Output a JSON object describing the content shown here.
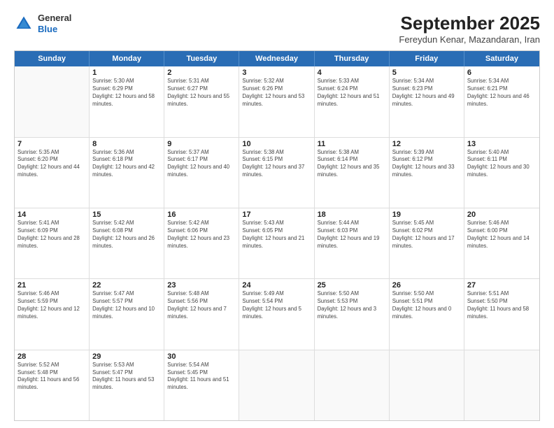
{
  "logo": {
    "general": "General",
    "blue": "Blue"
  },
  "title": "September 2025",
  "subtitle": "Fereydun Kenar, Mazandaran, Iran",
  "header_days": [
    "Sunday",
    "Monday",
    "Tuesday",
    "Wednesday",
    "Thursday",
    "Friday",
    "Saturday"
  ],
  "weeks": [
    [
      {
        "day": "",
        "sunrise": "",
        "sunset": "",
        "daylight": ""
      },
      {
        "day": "1",
        "sunrise": "Sunrise: 5:30 AM",
        "sunset": "Sunset: 6:29 PM",
        "daylight": "Daylight: 12 hours and 58 minutes."
      },
      {
        "day": "2",
        "sunrise": "Sunrise: 5:31 AM",
        "sunset": "Sunset: 6:27 PM",
        "daylight": "Daylight: 12 hours and 55 minutes."
      },
      {
        "day": "3",
        "sunrise": "Sunrise: 5:32 AM",
        "sunset": "Sunset: 6:26 PM",
        "daylight": "Daylight: 12 hours and 53 minutes."
      },
      {
        "day": "4",
        "sunrise": "Sunrise: 5:33 AM",
        "sunset": "Sunset: 6:24 PM",
        "daylight": "Daylight: 12 hours and 51 minutes."
      },
      {
        "day": "5",
        "sunrise": "Sunrise: 5:34 AM",
        "sunset": "Sunset: 6:23 PM",
        "daylight": "Daylight: 12 hours and 49 minutes."
      },
      {
        "day": "6",
        "sunrise": "Sunrise: 5:34 AM",
        "sunset": "Sunset: 6:21 PM",
        "daylight": "Daylight: 12 hours and 46 minutes."
      }
    ],
    [
      {
        "day": "7",
        "sunrise": "Sunrise: 5:35 AM",
        "sunset": "Sunset: 6:20 PM",
        "daylight": "Daylight: 12 hours and 44 minutes."
      },
      {
        "day": "8",
        "sunrise": "Sunrise: 5:36 AM",
        "sunset": "Sunset: 6:18 PM",
        "daylight": "Daylight: 12 hours and 42 minutes."
      },
      {
        "day": "9",
        "sunrise": "Sunrise: 5:37 AM",
        "sunset": "Sunset: 6:17 PM",
        "daylight": "Daylight: 12 hours and 40 minutes."
      },
      {
        "day": "10",
        "sunrise": "Sunrise: 5:38 AM",
        "sunset": "Sunset: 6:15 PM",
        "daylight": "Daylight: 12 hours and 37 minutes."
      },
      {
        "day": "11",
        "sunrise": "Sunrise: 5:38 AM",
        "sunset": "Sunset: 6:14 PM",
        "daylight": "Daylight: 12 hours and 35 minutes."
      },
      {
        "day": "12",
        "sunrise": "Sunrise: 5:39 AM",
        "sunset": "Sunset: 6:12 PM",
        "daylight": "Daylight: 12 hours and 33 minutes."
      },
      {
        "day": "13",
        "sunrise": "Sunrise: 5:40 AM",
        "sunset": "Sunset: 6:11 PM",
        "daylight": "Daylight: 12 hours and 30 minutes."
      }
    ],
    [
      {
        "day": "14",
        "sunrise": "Sunrise: 5:41 AM",
        "sunset": "Sunset: 6:09 PM",
        "daylight": "Daylight: 12 hours and 28 minutes."
      },
      {
        "day": "15",
        "sunrise": "Sunrise: 5:42 AM",
        "sunset": "Sunset: 6:08 PM",
        "daylight": "Daylight: 12 hours and 26 minutes."
      },
      {
        "day": "16",
        "sunrise": "Sunrise: 5:42 AM",
        "sunset": "Sunset: 6:06 PM",
        "daylight": "Daylight: 12 hours and 23 minutes."
      },
      {
        "day": "17",
        "sunrise": "Sunrise: 5:43 AM",
        "sunset": "Sunset: 6:05 PM",
        "daylight": "Daylight: 12 hours and 21 minutes."
      },
      {
        "day": "18",
        "sunrise": "Sunrise: 5:44 AM",
        "sunset": "Sunset: 6:03 PM",
        "daylight": "Daylight: 12 hours and 19 minutes."
      },
      {
        "day": "19",
        "sunrise": "Sunrise: 5:45 AM",
        "sunset": "Sunset: 6:02 PM",
        "daylight": "Daylight: 12 hours and 17 minutes."
      },
      {
        "day": "20",
        "sunrise": "Sunrise: 5:46 AM",
        "sunset": "Sunset: 6:00 PM",
        "daylight": "Daylight: 12 hours and 14 minutes."
      }
    ],
    [
      {
        "day": "21",
        "sunrise": "Sunrise: 5:46 AM",
        "sunset": "Sunset: 5:59 PM",
        "daylight": "Daylight: 12 hours and 12 minutes."
      },
      {
        "day": "22",
        "sunrise": "Sunrise: 5:47 AM",
        "sunset": "Sunset: 5:57 PM",
        "daylight": "Daylight: 12 hours and 10 minutes."
      },
      {
        "day": "23",
        "sunrise": "Sunrise: 5:48 AM",
        "sunset": "Sunset: 5:56 PM",
        "daylight": "Daylight: 12 hours and 7 minutes."
      },
      {
        "day": "24",
        "sunrise": "Sunrise: 5:49 AM",
        "sunset": "Sunset: 5:54 PM",
        "daylight": "Daylight: 12 hours and 5 minutes."
      },
      {
        "day": "25",
        "sunrise": "Sunrise: 5:50 AM",
        "sunset": "Sunset: 5:53 PM",
        "daylight": "Daylight: 12 hours and 3 minutes."
      },
      {
        "day": "26",
        "sunrise": "Sunrise: 5:50 AM",
        "sunset": "Sunset: 5:51 PM",
        "daylight": "Daylight: 12 hours and 0 minutes."
      },
      {
        "day": "27",
        "sunrise": "Sunrise: 5:51 AM",
        "sunset": "Sunset: 5:50 PM",
        "daylight": "Daylight: 11 hours and 58 minutes."
      }
    ],
    [
      {
        "day": "28",
        "sunrise": "Sunrise: 5:52 AM",
        "sunset": "Sunset: 5:48 PM",
        "daylight": "Daylight: 11 hours and 56 minutes."
      },
      {
        "day": "29",
        "sunrise": "Sunrise: 5:53 AM",
        "sunset": "Sunset: 5:47 PM",
        "daylight": "Daylight: 11 hours and 53 minutes."
      },
      {
        "day": "30",
        "sunrise": "Sunrise: 5:54 AM",
        "sunset": "Sunset: 5:45 PM",
        "daylight": "Daylight: 11 hours and 51 minutes."
      },
      {
        "day": "",
        "sunrise": "",
        "sunset": "",
        "daylight": ""
      },
      {
        "day": "",
        "sunrise": "",
        "sunset": "",
        "daylight": ""
      },
      {
        "day": "",
        "sunrise": "",
        "sunset": "",
        "daylight": ""
      },
      {
        "day": "",
        "sunrise": "",
        "sunset": "",
        "daylight": ""
      }
    ]
  ]
}
